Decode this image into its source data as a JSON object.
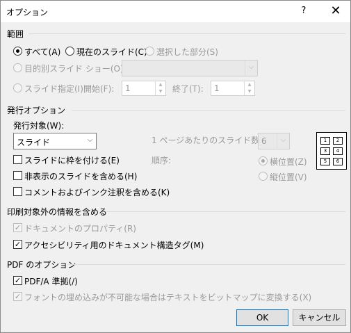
{
  "window": {
    "title": "オプション",
    "help_glyph": "?",
    "close_glyph": "✕"
  },
  "range": {
    "heading": "範囲",
    "all_label": "すべて(A)",
    "current_slide_label": "現在のスライド(C)",
    "selection_label": "選択した部分(S)",
    "custom_show_label": "目的別スライド ショー(O):",
    "slides_label": "スライド指定(I)",
    "from_label": "開始(F):",
    "from_value": "1",
    "to_label": "終了(T):",
    "to_value": "1"
  },
  "publish": {
    "heading": "発行オプション",
    "what_label": "発行対象(W):",
    "what_value": "スライド",
    "frame_label": "スライドに枠を付ける(E)",
    "hidden_label": "非表示のスライドを含める(H)",
    "comments_label": "コメントおよびインク注釈を含める(K)",
    "per_page_label": "1 ページあたりのスライド数(L):",
    "per_page_value": "6",
    "order_label": "順序:",
    "horizontal_label": "横位置(Z)",
    "vertical_label": "縦位置(V)",
    "thumb_numbers": [
      "1",
      "2",
      "3",
      "4",
      "5",
      "6"
    ]
  },
  "nonprint": {
    "heading": "印刷対象外の情報を含める",
    "doc_props_label": "ドキュメントのプロパティ(R)",
    "accessibility_label": "アクセシビリティ用のドキュメント構造タグ(M)"
  },
  "pdf": {
    "heading": "PDF のオプション",
    "pdfa_label": "PDF/A 準拠(/)",
    "bitmap_label": "フォントの埋め込みが不可能な場合はテキストをビットマップに変換する(X)"
  },
  "buttons": {
    "ok": "OK",
    "cancel": "キャンセル"
  },
  "glyphs": {
    "check": "✓",
    "combo_arrow": "⌵",
    "spin_up": "▲",
    "spin_down": "▼"
  }
}
